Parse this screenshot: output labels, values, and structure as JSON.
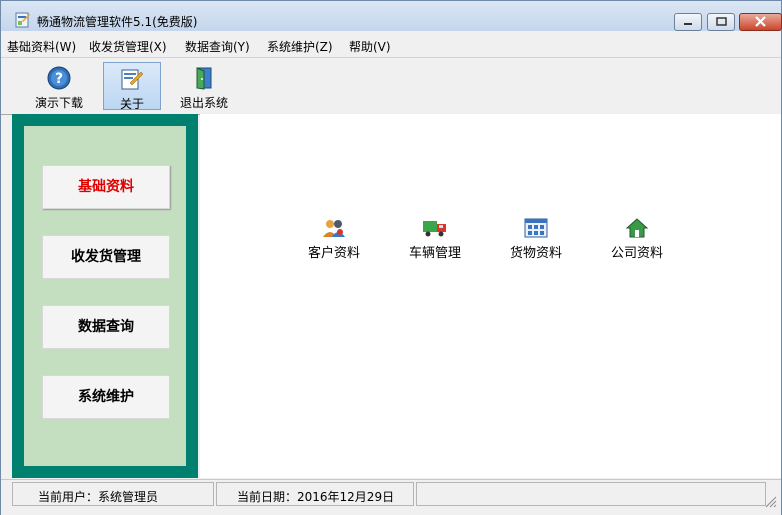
{
  "window": {
    "title": "畅通物流管理软件5.1(免费版)",
    "minimize_icon": "minimize-icon",
    "maximize_icon": "maximize-icon",
    "close_icon": "close-icon"
  },
  "menu": {
    "items": [
      {
        "label": "基础资料(W)"
      },
      {
        "label": "收发货管理(X)"
      },
      {
        "label": "数据查询(Y)"
      },
      {
        "label": "系统维护(Z)"
      },
      {
        "label": "帮助(V)"
      }
    ]
  },
  "toolbar": {
    "buttons": [
      {
        "label": "演示下载",
        "icon": "help-icon"
      },
      {
        "label": "关于",
        "icon": "about-icon",
        "active": true
      },
      {
        "label": "退出系统",
        "icon": "exit-door-icon"
      }
    ]
  },
  "sidebar": {
    "accent": "#00806f",
    "panel_color": "#c4dec0",
    "selected_color": "#e00000",
    "items": [
      {
        "label": "基础资料",
        "selected": true
      },
      {
        "label": "收发货管理"
      },
      {
        "label": "数据查询"
      },
      {
        "label": "系统维护"
      }
    ]
  },
  "main": {
    "tiles": [
      {
        "label": "客户资料",
        "icon": "customers-icon"
      },
      {
        "label": "车辆管理",
        "icon": "truck-icon"
      },
      {
        "label": "货物资料",
        "icon": "goods-icon"
      },
      {
        "label": "公司资料",
        "icon": "company-house-icon"
      }
    ]
  },
  "status": {
    "user": "当前用户：系统管理员",
    "date": "当前日期：2016年12月29日"
  }
}
